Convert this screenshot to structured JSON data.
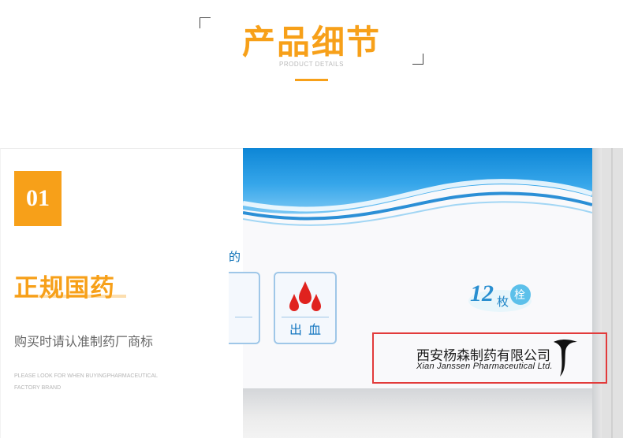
{
  "header": {
    "title": "产品细节",
    "subtitle": "PRODUCT DETAILS"
  },
  "feature": {
    "number": "01",
    "heading": "正规国药",
    "description": "购买时请认准制药厂商标",
    "english_note": "PLEASE LOOK FOR WHEN BUYINGPHARMACEUTICAL FACTORY BRAND"
  },
  "package": {
    "fragment_text": "的",
    "icon_label": "出血",
    "badge_number": "12",
    "badge_text": "枚",
    "badge_circle": "栓",
    "company_cn": "西安杨森制药有限公司",
    "company_en": "Xian Janssen Pharmaceutical Ltd."
  },
  "colors": {
    "accent": "#f7a019",
    "package_blue": "#1a8fd8",
    "highlight_red": "#e23b3b"
  },
  "icons": {
    "blood": "blood-drops-icon",
    "logo": "janssen-logo-icon"
  }
}
